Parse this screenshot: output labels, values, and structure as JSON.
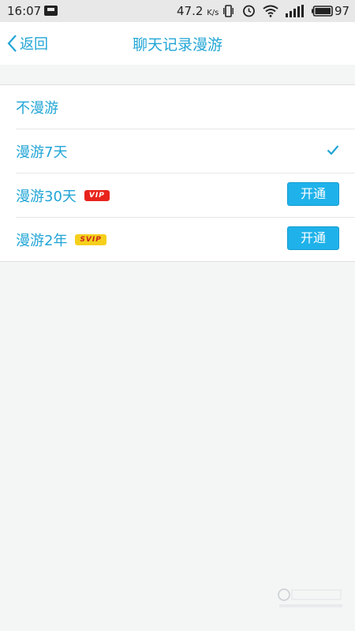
{
  "status_bar": {
    "time": "16:07",
    "net_speed_value": "47.2",
    "net_speed_unit": "K/s",
    "battery_level": "97"
  },
  "nav": {
    "back_label": "返回",
    "title": "聊天记录漫游"
  },
  "options": [
    {
      "label": "不漫游"
    },
    {
      "label": "漫游7天",
      "selected": true
    },
    {
      "label": "漫游30天",
      "badge": "VIP",
      "action": "开通"
    },
    {
      "label": "漫游2年",
      "badge": "SVIP",
      "action": "开通"
    }
  ],
  "colors": {
    "accent": "#21a5d6",
    "button": "#1fb2ea",
    "vip_badge": "#e8231c",
    "svip_badge": "#f6cf1c",
    "background": "#f4f5f5"
  },
  "icons": [
    "back-chevron-icon",
    "check-icon",
    "vibrate-icon",
    "alarm-icon",
    "wifi-icon",
    "signal-icon",
    "battery-icon"
  ]
}
